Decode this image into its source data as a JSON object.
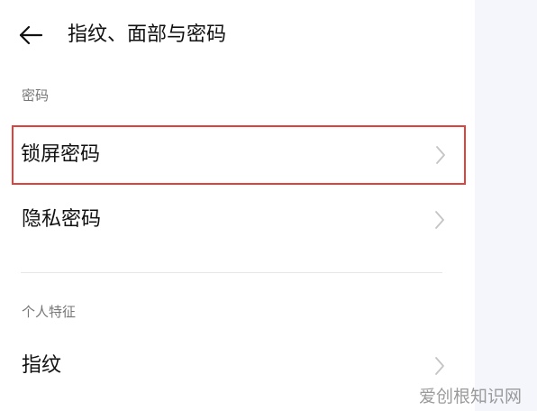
{
  "header": {
    "back_icon": "arrow-left-icon",
    "title": "指纹、面部与密码"
  },
  "sections": [
    {
      "header": "密码",
      "items": [
        {
          "label": "锁屏密码",
          "icon": "chevron-right-icon",
          "highlighted": true
        },
        {
          "label": "隐私密码",
          "icon": "chevron-right-icon",
          "highlighted": false
        }
      ]
    },
    {
      "header": "个人特征",
      "items": [
        {
          "label": "指纹",
          "icon": "chevron-right-icon",
          "highlighted": false
        }
      ]
    }
  ],
  "colors": {
    "highlight_border": "#e0413a",
    "text_primary": "#111111",
    "text_secondary": "#777777",
    "chevron": "#c4c4c4",
    "side_background": "#f5f6fb"
  },
  "watermark": "爱创根知识网"
}
